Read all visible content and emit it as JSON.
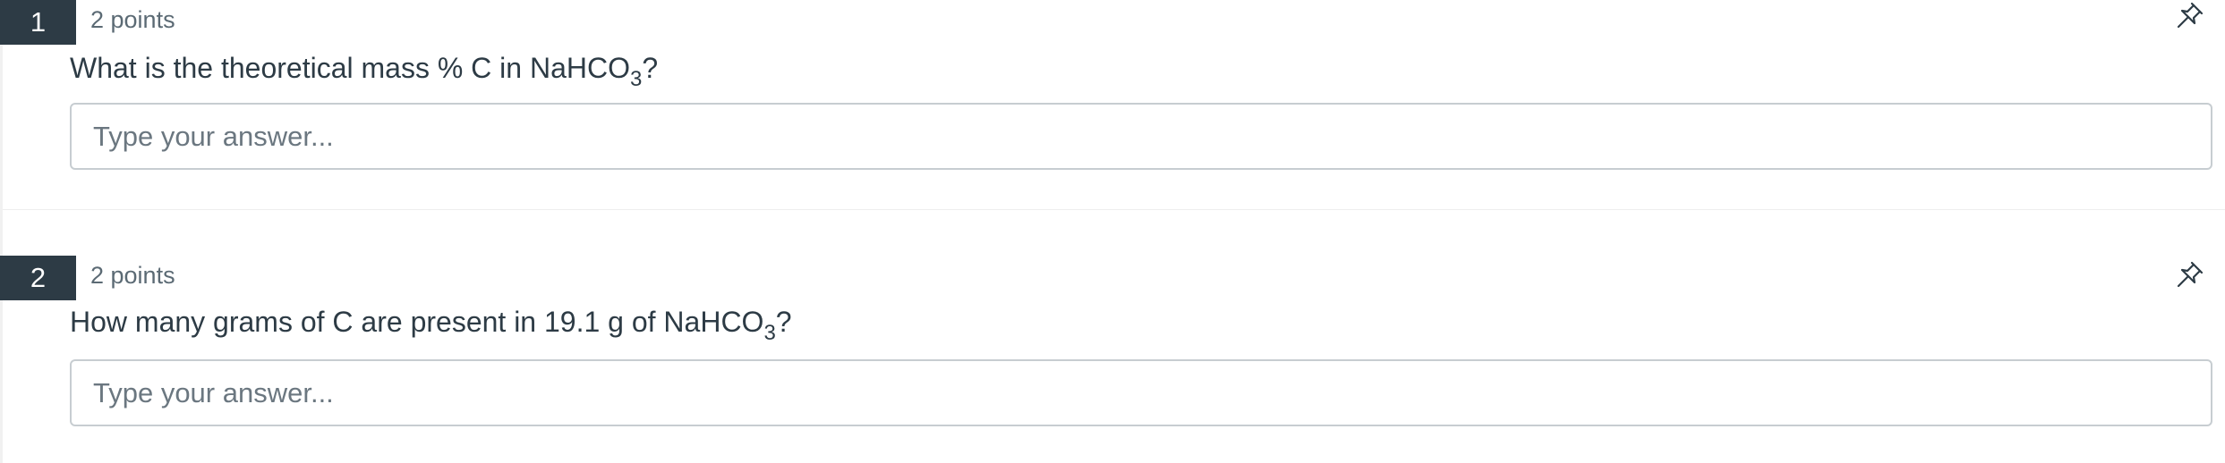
{
  "questions": [
    {
      "number": "1",
      "points": "2 points",
      "text_before": "What is the theoretical mass % C in NaHCO",
      "subscript": "3",
      "text_after": "?",
      "answer_placeholder": "Type your answer...",
      "answer_value": "",
      "pin_icon": "pin-icon"
    },
    {
      "number": "2",
      "points": "2 points",
      "text_before": "How many grams of C are present in 19.1 g of NaHCO",
      "subscript": "3",
      "text_after": "?",
      "answer_placeholder": "Type your answer...",
      "answer_value": "",
      "pin_icon": "pin-icon"
    }
  ],
  "colors": {
    "number_badge_bg": "#2d3b45",
    "number_badge_text": "#ffffff",
    "text": "#2d3b45",
    "muted_text": "#5b6a74",
    "input_border": "#c7cdd1",
    "divider": "#eeeeee"
  }
}
